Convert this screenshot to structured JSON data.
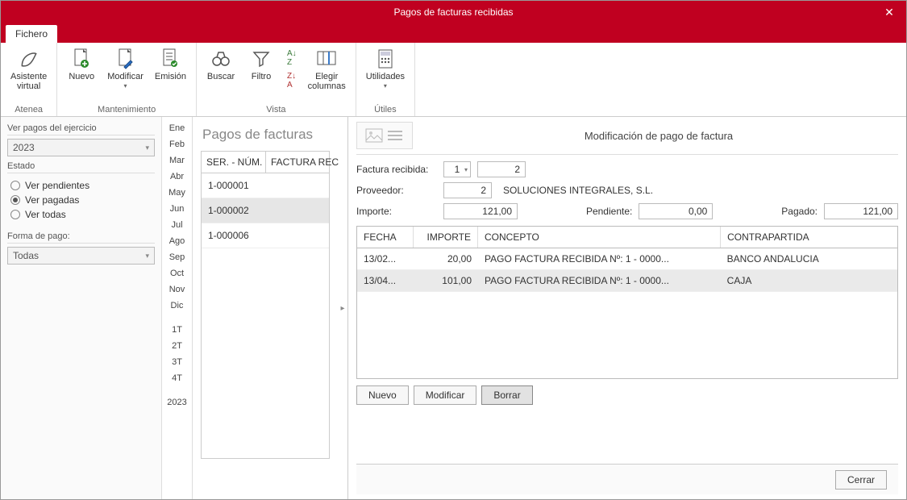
{
  "window": {
    "title": "Pagos de facturas recibidas"
  },
  "tabs": {
    "fichero": "Fichero"
  },
  "ribbon": {
    "asistente": {
      "line1": "Asistente",
      "line2": "virtual"
    },
    "nuevo": "Nuevo",
    "modificar": "Modificar",
    "emision": "Emisión",
    "buscar": "Buscar",
    "filtro": "Filtro",
    "elegir": {
      "line1": "Elegir",
      "line2": "columnas"
    },
    "utilidades": "Utilidades",
    "groups": {
      "atenea": "Atenea",
      "mant": "Mantenimiento",
      "vista": "Vista",
      "utiles": "Útiles"
    }
  },
  "left": {
    "ver_pagos": "Ver pagos del ejercicio",
    "year": "2023",
    "estado_label": "Estado",
    "estado": {
      "pendientes": "Ver pendientes",
      "pagadas": "Ver pagadas",
      "todas": "Ver todas"
    },
    "forma_label": "Forma de pago:",
    "forma_value": "Todas"
  },
  "months": [
    "Ene",
    "Feb",
    "Mar",
    "Abr",
    "May",
    "Jun",
    "Jul",
    "Ago",
    "Sep",
    "Oct",
    "Nov",
    "Dic",
    "",
    "1T",
    "2T",
    "3T",
    "4T",
    "",
    "2023"
  ],
  "list": {
    "title": "Pagos de facturas",
    "col_ser": "SER. - NÚM.",
    "col_fact": "FACTURA REC",
    "rows": [
      "1-000001",
      "1-000002",
      "1-000006"
    ]
  },
  "detail": {
    "title": "Modificación de pago de factura",
    "factura_label": "Factura recibida:",
    "factura_ser": "1",
    "factura_num": "2",
    "proveedor_label": "Proveedor:",
    "proveedor_cod": "2",
    "proveedor_name": "SOLUCIONES INTEGRALES, S.L.",
    "importe_label": "Importe:",
    "importe": "121,00",
    "pendiente_label": "Pendiente:",
    "pendiente": "0,00",
    "pagado_label": "Pagado:",
    "pagado": "121,00",
    "cols": {
      "fecha": "FECHA",
      "importe": "IMPORTE",
      "concepto": "CONCEPTO",
      "contra": "CONTRAPARTIDA"
    },
    "rows": [
      {
        "fecha": "13/02...",
        "importe": "20,00",
        "concepto": "PAGO FACTURA RECIBIDA Nº: 1 - 0000...",
        "contra": "BANCO ANDALUCIA"
      },
      {
        "fecha": "13/04...",
        "importe": "101,00",
        "concepto": "PAGO FACTURA RECIBIDA Nº: 1 - 0000...",
        "contra": "CAJA"
      }
    ],
    "btn_nuevo": "Nuevo",
    "btn_modificar": "Modificar",
    "btn_borrar": "Borrar"
  },
  "footer": {
    "cerrar": "Cerrar"
  }
}
